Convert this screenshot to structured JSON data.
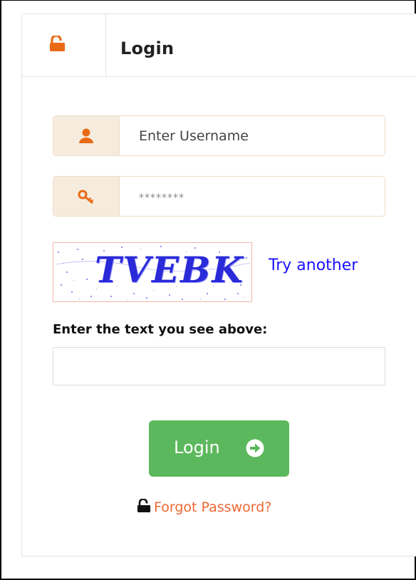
{
  "header": {
    "title": "Login",
    "icon": "unlock-icon"
  },
  "username": {
    "placeholder": "Enter Username",
    "icon": "user-icon"
  },
  "password": {
    "placeholder": "********",
    "icon": "key-icon"
  },
  "captcha": {
    "image_text": "TVEBK",
    "refresh_label": "Try another",
    "instruction": "Enter the text you see above:",
    "input_value": ""
  },
  "login_button": {
    "label": "Login",
    "icon": "arrow-circle-right-icon"
  },
  "forgot": {
    "label": "Forgot Password?",
    "icon": "unlock-icon"
  },
  "colors": {
    "accent_orange": "#e96a16",
    "addon_bg": "#f6ecde",
    "button_green": "#5cb85c",
    "link_blue": "#1a12ff",
    "forgot_link": "#ee6633"
  }
}
